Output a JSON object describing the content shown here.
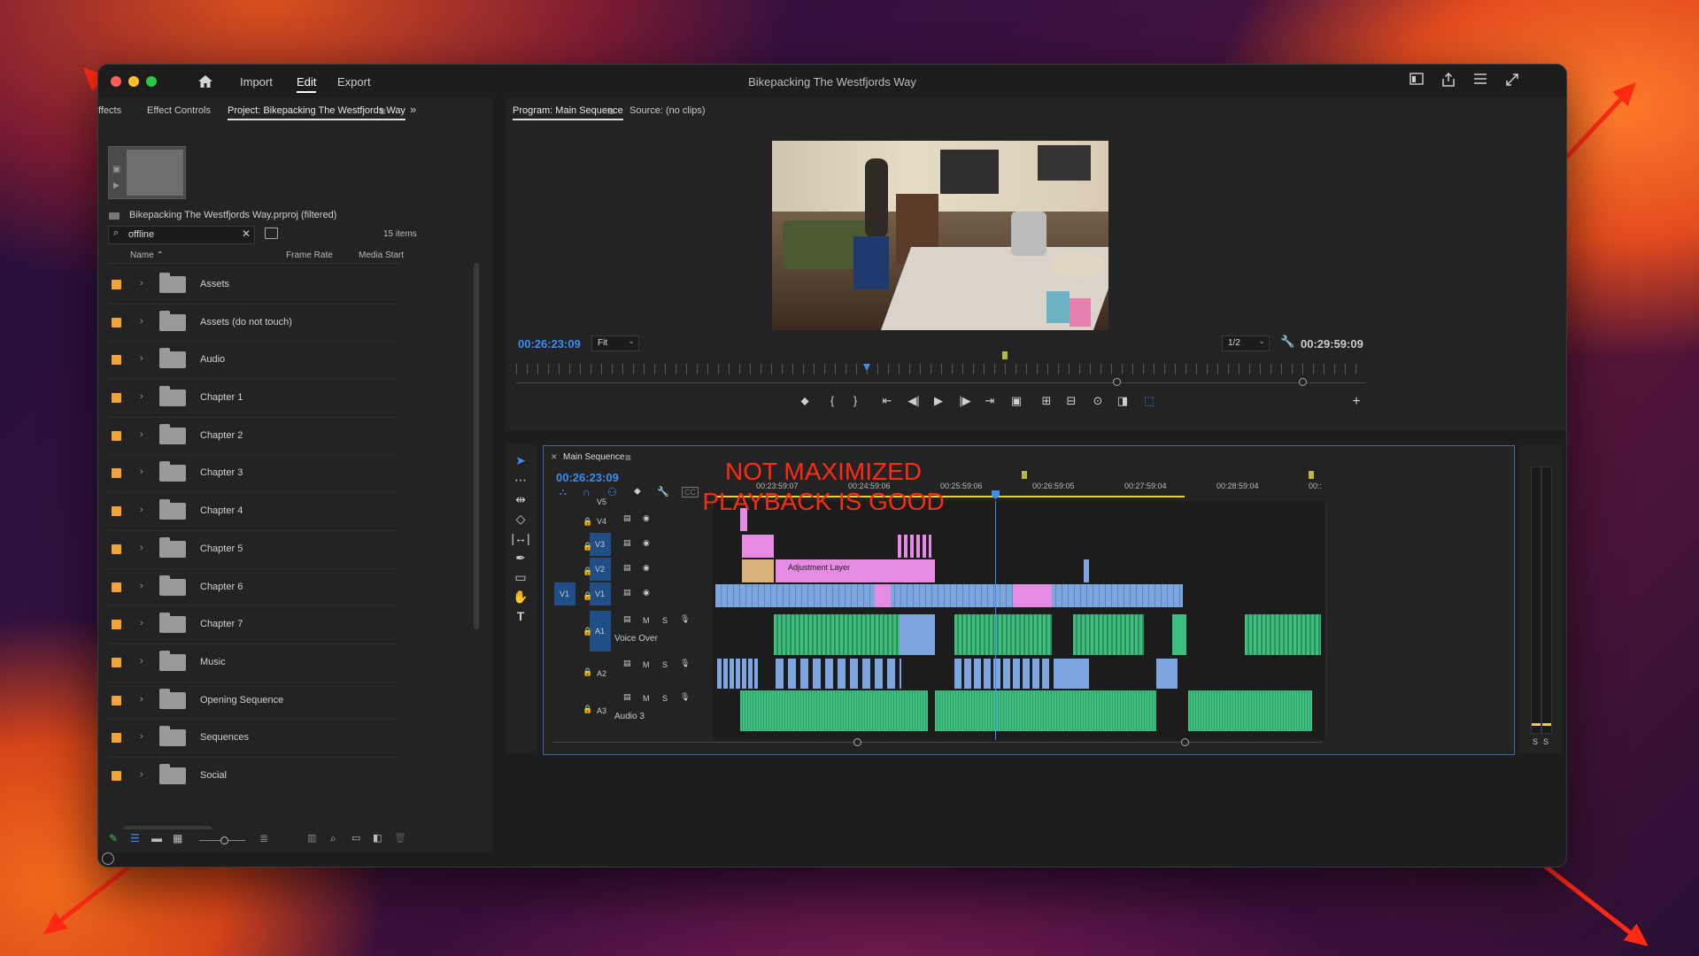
{
  "window": {
    "title": "Bikepacking The Westfjords Way",
    "menu": [
      "Import",
      "Edit",
      "Export"
    ],
    "active_menu": "Edit"
  },
  "left_panel": {
    "tabs": [
      "ffects",
      "Effect Controls",
      "Project: Bikepacking The Westfjords Way"
    ],
    "project_file": "Bikepacking The Westfjords Way.prproj (filtered)",
    "search_value": "offline",
    "item_count": "15 items",
    "columns": [
      "Name",
      "Frame Rate",
      "Media Start"
    ],
    "items": [
      "Assets",
      "Assets (do not touch)",
      "Audio",
      "Chapter 1",
      "Chapter 2",
      "Chapter 3",
      "Chapter 4",
      "Chapter 5",
      "Chapter 6",
      "Chapter 7",
      "Music",
      "Opening Sequence",
      "Sequences",
      "Social"
    ]
  },
  "program": {
    "tabs": [
      "Program: Main Sequence",
      "Source: (no clips)"
    ],
    "timecode": "00:26:23:09",
    "fit": "Fit",
    "resolution": "1/2",
    "duration": "00:29:59:09"
  },
  "timeline": {
    "sequence_name": "Main Sequence",
    "timecode": "00:26:23:09",
    "ruler_labels": [
      "00:23:59:07",
      "00:24:59:06",
      "00:25:59:06",
      "00:26:59:05",
      "00:27:59:04",
      "00:28:59:04",
      "00::"
    ],
    "tracks": {
      "video": [
        "V5",
        "V4",
        "V3",
        "V2",
        "V1"
      ],
      "audio": [
        "A1",
        "A2",
        "A3"
      ],
      "source_v": "V1",
      "a1_name": "Voice Over",
      "a3_name": "Audio 3"
    },
    "clip_label": "Adjustment Layer",
    "track_buttons": {
      "mute": "M",
      "solo": "S"
    },
    "meter_labels": [
      "S",
      "S"
    ]
  },
  "annotation": {
    "line1": "NOT MAXIMIZED",
    "line2": "PLAYBACK IS GOOD",
    "color": "#ff2a12"
  },
  "colors": {
    "accent_blue": "#3d8ef0",
    "label_orange": "#f3a33a",
    "clip_pink": "#e58be3",
    "clip_blue": "#7ea6de",
    "audio_green": "#3fbf7f"
  }
}
